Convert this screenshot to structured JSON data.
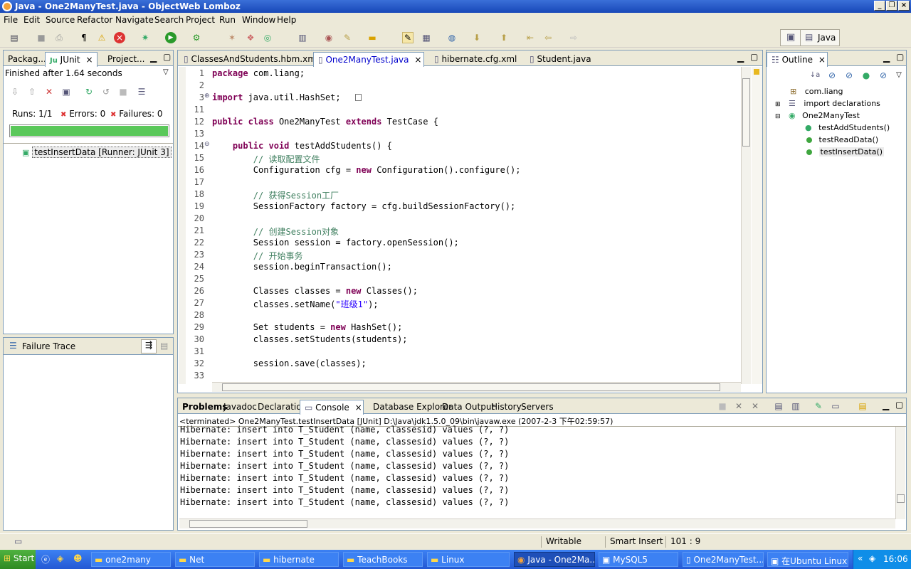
{
  "window": {
    "title": "Java - One2ManyTest.java - ObjectWeb Lomboz"
  },
  "menu": [
    "File",
    "Edit",
    "Source",
    "Refactor",
    "Navigate",
    "Search",
    "Project",
    "Run",
    "Window",
    "Help"
  ],
  "perspective": {
    "label": "Java"
  },
  "left_panel": {
    "tabs": [
      "Packag...",
      "JUnit",
      "Project..."
    ],
    "status": "Finished after 1.64 seconds",
    "runs_label": "Runs:",
    "runs_value": "1/1",
    "errors_label": "Errors:",
    "errors_value": "0",
    "failures_label": "Failures:",
    "failures_value": "0",
    "progress": 1.0,
    "tree_item": "testInsertData [Runner: JUnit 3]",
    "failure_trace_title": "Failure Trace"
  },
  "editor": {
    "tabs": [
      "ClassesAndStudents.hbm.xml",
      "One2ManyTest.java",
      "hibernate.cfg.xml",
      "Student.java"
    ],
    "lines": [
      {
        "n": "1",
        "code": [
          {
            "t": "package",
            "k": "kw"
          },
          {
            "t": " com.liang;"
          }
        ]
      },
      {
        "n": "2",
        "code": []
      },
      {
        "n": "3",
        "code": [
          {
            "t": "import",
            "k": "kw"
          },
          {
            "t": " java.util.HashSet;"
          }
        ]
      },
      {
        "n": "11",
        "code": []
      },
      {
        "n": "12",
        "code": [
          {
            "t": "public",
            "k": "kw"
          },
          {
            "t": " "
          },
          {
            "t": "class",
            "k": "kw"
          },
          {
            "t": " One2ManyTest "
          },
          {
            "t": "extends",
            "k": "kw"
          },
          {
            "t": " TestCase {"
          }
        ]
      },
      {
        "n": "13",
        "code": []
      },
      {
        "n": "14",
        "code": [
          {
            "t": "    "
          },
          {
            "t": "public",
            "k": "kw"
          },
          {
            "t": " "
          },
          {
            "t": "void",
            "k": "kw"
          },
          {
            "t": " testAddStudents() {"
          }
        ]
      },
      {
        "n": "15",
        "code": [
          {
            "t": "        "
          },
          {
            "t": "// 读取配置文件",
            "k": "cm"
          }
        ]
      },
      {
        "n": "16",
        "code": [
          {
            "t": "        Configuration cfg = "
          },
          {
            "t": "new",
            "k": "kw"
          },
          {
            "t": " Configuration().configure();"
          }
        ]
      },
      {
        "n": "17",
        "code": []
      },
      {
        "n": "18",
        "code": [
          {
            "t": "        "
          },
          {
            "t": "// 获得Session工厂",
            "k": "cm"
          }
        ]
      },
      {
        "n": "19",
        "code": [
          {
            "t": "        SessionFactory factory = cfg.buildSessionFactory();"
          }
        ]
      },
      {
        "n": "20",
        "code": []
      },
      {
        "n": "21",
        "code": [
          {
            "t": "        "
          },
          {
            "t": "// 创建Session对象",
            "k": "cm"
          }
        ]
      },
      {
        "n": "22",
        "code": [
          {
            "t": "        Session session = factory.openSession();"
          }
        ]
      },
      {
        "n": "23",
        "code": [
          {
            "t": "        "
          },
          {
            "t": "// 开始事务",
            "k": "cm"
          }
        ]
      },
      {
        "n": "24",
        "code": [
          {
            "t": "        session.beginTransaction();"
          }
        ]
      },
      {
        "n": "25",
        "code": []
      },
      {
        "n": "26",
        "code": [
          {
            "t": "        Classes classes = "
          },
          {
            "t": "new",
            "k": "kw"
          },
          {
            "t": " Classes();"
          }
        ]
      },
      {
        "n": "27",
        "code": [
          {
            "t": "        classes.setName("
          },
          {
            "t": "\"班级1\"",
            "k": "st"
          },
          {
            "t": ");"
          }
        ]
      },
      {
        "n": "28",
        "code": []
      },
      {
        "n": "29",
        "code": [
          {
            "t": "        Set students = "
          },
          {
            "t": "new",
            "k": "kw"
          },
          {
            "t": " HashSet();"
          }
        ]
      },
      {
        "n": "30",
        "code": [
          {
            "t": "        classes.setStudents(students);"
          }
        ]
      },
      {
        "n": "31",
        "code": []
      },
      {
        "n": "32",
        "code": [
          {
            "t": "        session.save(classes);"
          }
        ]
      },
      {
        "n": "33",
        "code": []
      }
    ]
  },
  "outline": {
    "tab": "Outline",
    "items": [
      "com.liang",
      "import declarations",
      "One2ManyTest",
      "testAddStudents()",
      "testReadData()",
      "testInsertData()"
    ]
  },
  "bottom": {
    "tabs": [
      "Problems",
      "Javadoc",
      "Declaration",
      "Console",
      "Database Explorer",
      "Data Output",
      "History",
      "Servers"
    ],
    "terminated": "<terminated> One2ManyTest.testInsertData [JUnit] D:\\Java\\jdk1.5.0_09\\bin\\javaw.exe (2007-2-3 下午02:59:57)",
    "console_lines": [
      "Hibernate: insert into T_Student (name, classesid) values (?, ?)",
      "Hibernate: insert into T_Student (name, classesid) values (?, ?)",
      "Hibernate: insert into T_Student (name, classesid) values (?, ?)",
      "Hibernate: insert into T_Student (name, classesid) values (?, ?)",
      "Hibernate: insert into T_Student (name, classesid) values (?, ?)",
      "Hibernate: insert into T_Student (name, classesid) values (?, ?)",
      "Hibernate: insert into T_Student (name, classesid) values (?, ?)"
    ]
  },
  "status": {
    "writable": "Writable",
    "insert_mode": "Smart Insert",
    "position": "101 : 9"
  },
  "taskbar": {
    "start": "Start",
    "tasks": [
      "one2many",
      "Net",
      "hibernate",
      "TeachBooks",
      "Linux",
      "Java - One2Ma...",
      "MySQL5",
      "One2ManyTest...",
      "在Ubuntu Linux..."
    ],
    "clock": "16:06"
  }
}
